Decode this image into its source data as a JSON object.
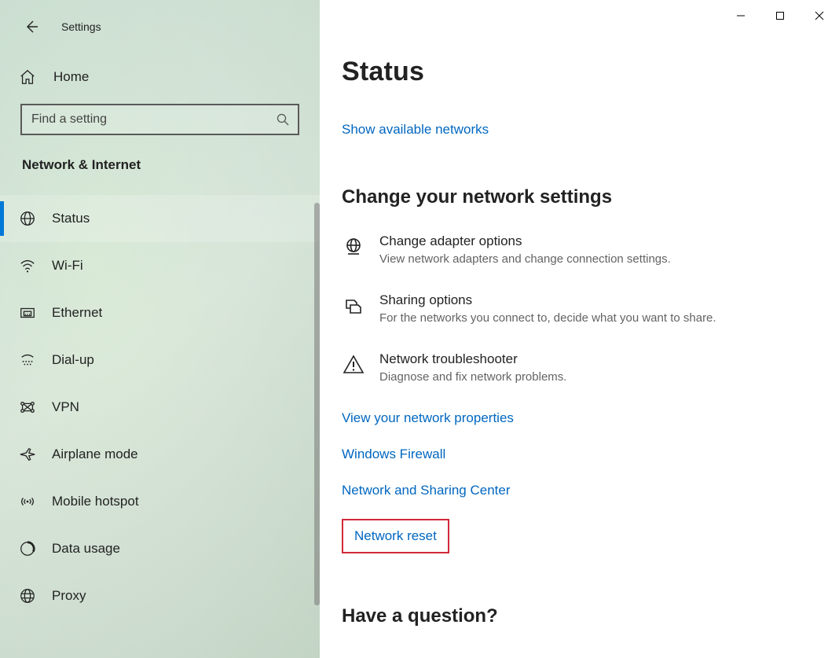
{
  "window": {
    "title": "Settings"
  },
  "sidebar": {
    "home_label": "Home",
    "search_placeholder": "Find a setting",
    "category": "Network & Internet",
    "items": [
      {
        "label": "Status",
        "icon": "globe-icon"
      },
      {
        "label": "Wi-Fi",
        "icon": "wifi-icon"
      },
      {
        "label": "Ethernet",
        "icon": "ethernet-icon"
      },
      {
        "label": "Dial-up",
        "icon": "dialup-icon"
      },
      {
        "label": "VPN",
        "icon": "vpn-icon"
      },
      {
        "label": "Airplane mode",
        "icon": "airplane-icon"
      },
      {
        "label": "Mobile hotspot",
        "icon": "hotspot-icon"
      },
      {
        "label": "Data usage",
        "icon": "datausage-icon"
      },
      {
        "label": "Proxy",
        "icon": "proxy-icon"
      }
    ],
    "active_index": 0
  },
  "content": {
    "page_title": "Status",
    "show_networks_link": "Show available networks",
    "change_heading": "Change your network settings",
    "settings": [
      {
        "title": "Change adapter options",
        "desc": "View network adapters and change connection settings.",
        "icon": "adapter-icon"
      },
      {
        "title": "Sharing options",
        "desc": "For the networks you connect to, decide what you want to share.",
        "icon": "sharing-icon"
      },
      {
        "title": "Network troubleshooter",
        "desc": "Diagnose and fix network problems.",
        "icon": "troubleshoot-icon"
      }
    ],
    "links": [
      "View your network properties",
      "Windows Firewall",
      "Network and Sharing Center",
      "Network reset"
    ],
    "highlighted_link_index": 3,
    "question_heading": "Have a question?"
  }
}
